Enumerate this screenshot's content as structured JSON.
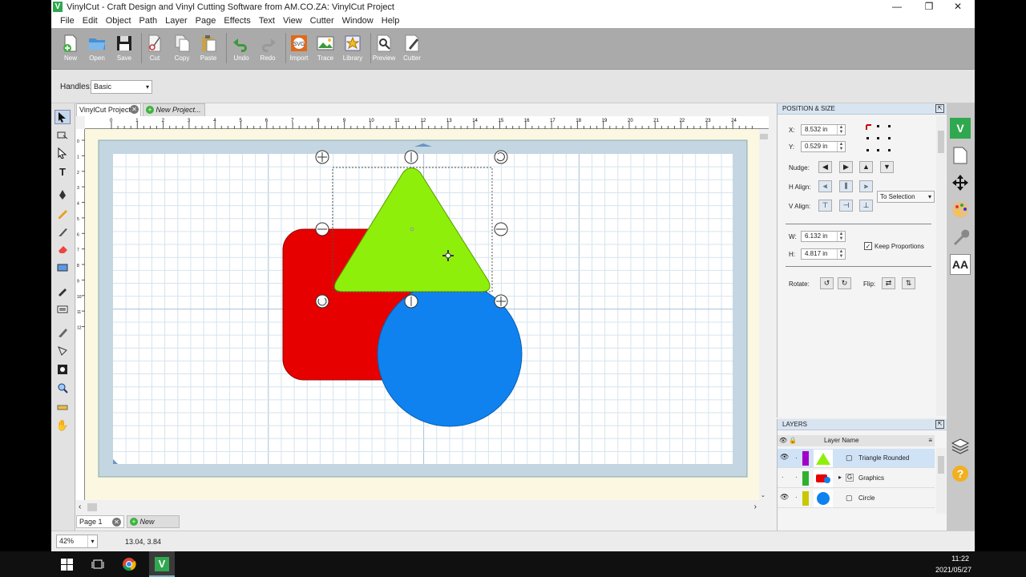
{
  "window": {
    "title": "VinylCut - Craft Design and Vinyl Cutting Software from AM.CO.ZA: VinylCut Project",
    "logo_letter": "V",
    "minimize": "—",
    "restore": "❐",
    "close": "✕"
  },
  "menu": [
    "File",
    "Edit",
    "Object",
    "Path",
    "Layer",
    "Page",
    "Effects",
    "Text",
    "View",
    "Cutter",
    "Window",
    "Help"
  ],
  "toolbar": [
    {
      "label": "New",
      "icon": "new-icon"
    },
    {
      "label": "Open",
      "icon": "open-folder-icon"
    },
    {
      "label": "Save",
      "icon": "floppy-disk-icon"
    },
    {
      "label": "Cut",
      "icon": "scissors-icon"
    },
    {
      "label": "Copy",
      "icon": "copy-icon"
    },
    {
      "label": "Paste",
      "icon": "paste-clipboard-icon"
    },
    {
      "label": "Undo",
      "icon": "undo-icon"
    },
    {
      "label": "Redo",
      "icon": "redo-icon"
    },
    {
      "label": "Import",
      "icon": "import-svg-icon"
    },
    {
      "label": "Trace",
      "icon": "trace-image-icon"
    },
    {
      "label": "Library",
      "icon": "library-star-icon"
    },
    {
      "label": "Preview",
      "icon": "preview-magnifier-icon"
    },
    {
      "label": "Cutter",
      "icon": "cutter-icon"
    }
  ],
  "options": {
    "handles_label": "Handles:",
    "handles_value": "Basic"
  },
  "tabs": {
    "doc_tab": "VinylCut Project",
    "new_project": "New Project...",
    "page_tab": "Page 1",
    "new_page": "New Page..."
  },
  "ruler": {
    "top_labels": [
      "0",
      "1",
      "2",
      "3",
      "4",
      "5",
      "6",
      "7",
      "8",
      "9",
      "10",
      "11",
      "12",
      "13",
      "14",
      "15",
      "16",
      "17",
      "18",
      "19",
      "20",
      "21",
      "22",
      "23",
      "24"
    ],
    "left_labels": [
      "0",
      "1",
      "2",
      "3",
      "4",
      "5",
      "6",
      "7",
      "8",
      "9",
      "10",
      "11",
      "12"
    ]
  },
  "canvas": {
    "shape_colors": {
      "rectangle": "#e60000",
      "triangle": "#8ef00a",
      "circle": "#0f82ef"
    }
  },
  "position_size": {
    "title": "POSITION & SIZE",
    "x_label": "X:",
    "x_value": "8.532 in",
    "y_label": "Y:",
    "y_value": "0.529 in",
    "nudge_label": "Nudge:",
    "halign_label": "H Align:",
    "valign_label": "V Align:",
    "align_to": "To Selection",
    "w_label": "W:",
    "w_value": "6.132 in",
    "h_label": "H:",
    "h_value": "4.817 in",
    "keep_proportions": "Keep Proportions",
    "rotate_label": "Rotate:",
    "flip_label": "Flip:"
  },
  "layers": {
    "title": "LAYERS",
    "column": "Layer Name",
    "items": [
      {
        "name": "Triangle Rounded",
        "color": "#8ef00a",
        "tag": "#a000c8"
      },
      {
        "name": "Graphics",
        "color": "#e60000",
        "tag": "#30b030"
      },
      {
        "name": "Circle",
        "color": "#0f82ef",
        "tag": "#c8c800"
      }
    ]
  },
  "status": {
    "zoom": "42%",
    "coords": "13.04, 3.84"
  },
  "taskbar": {
    "time": "11:22",
    "date": "2021/05/27"
  }
}
